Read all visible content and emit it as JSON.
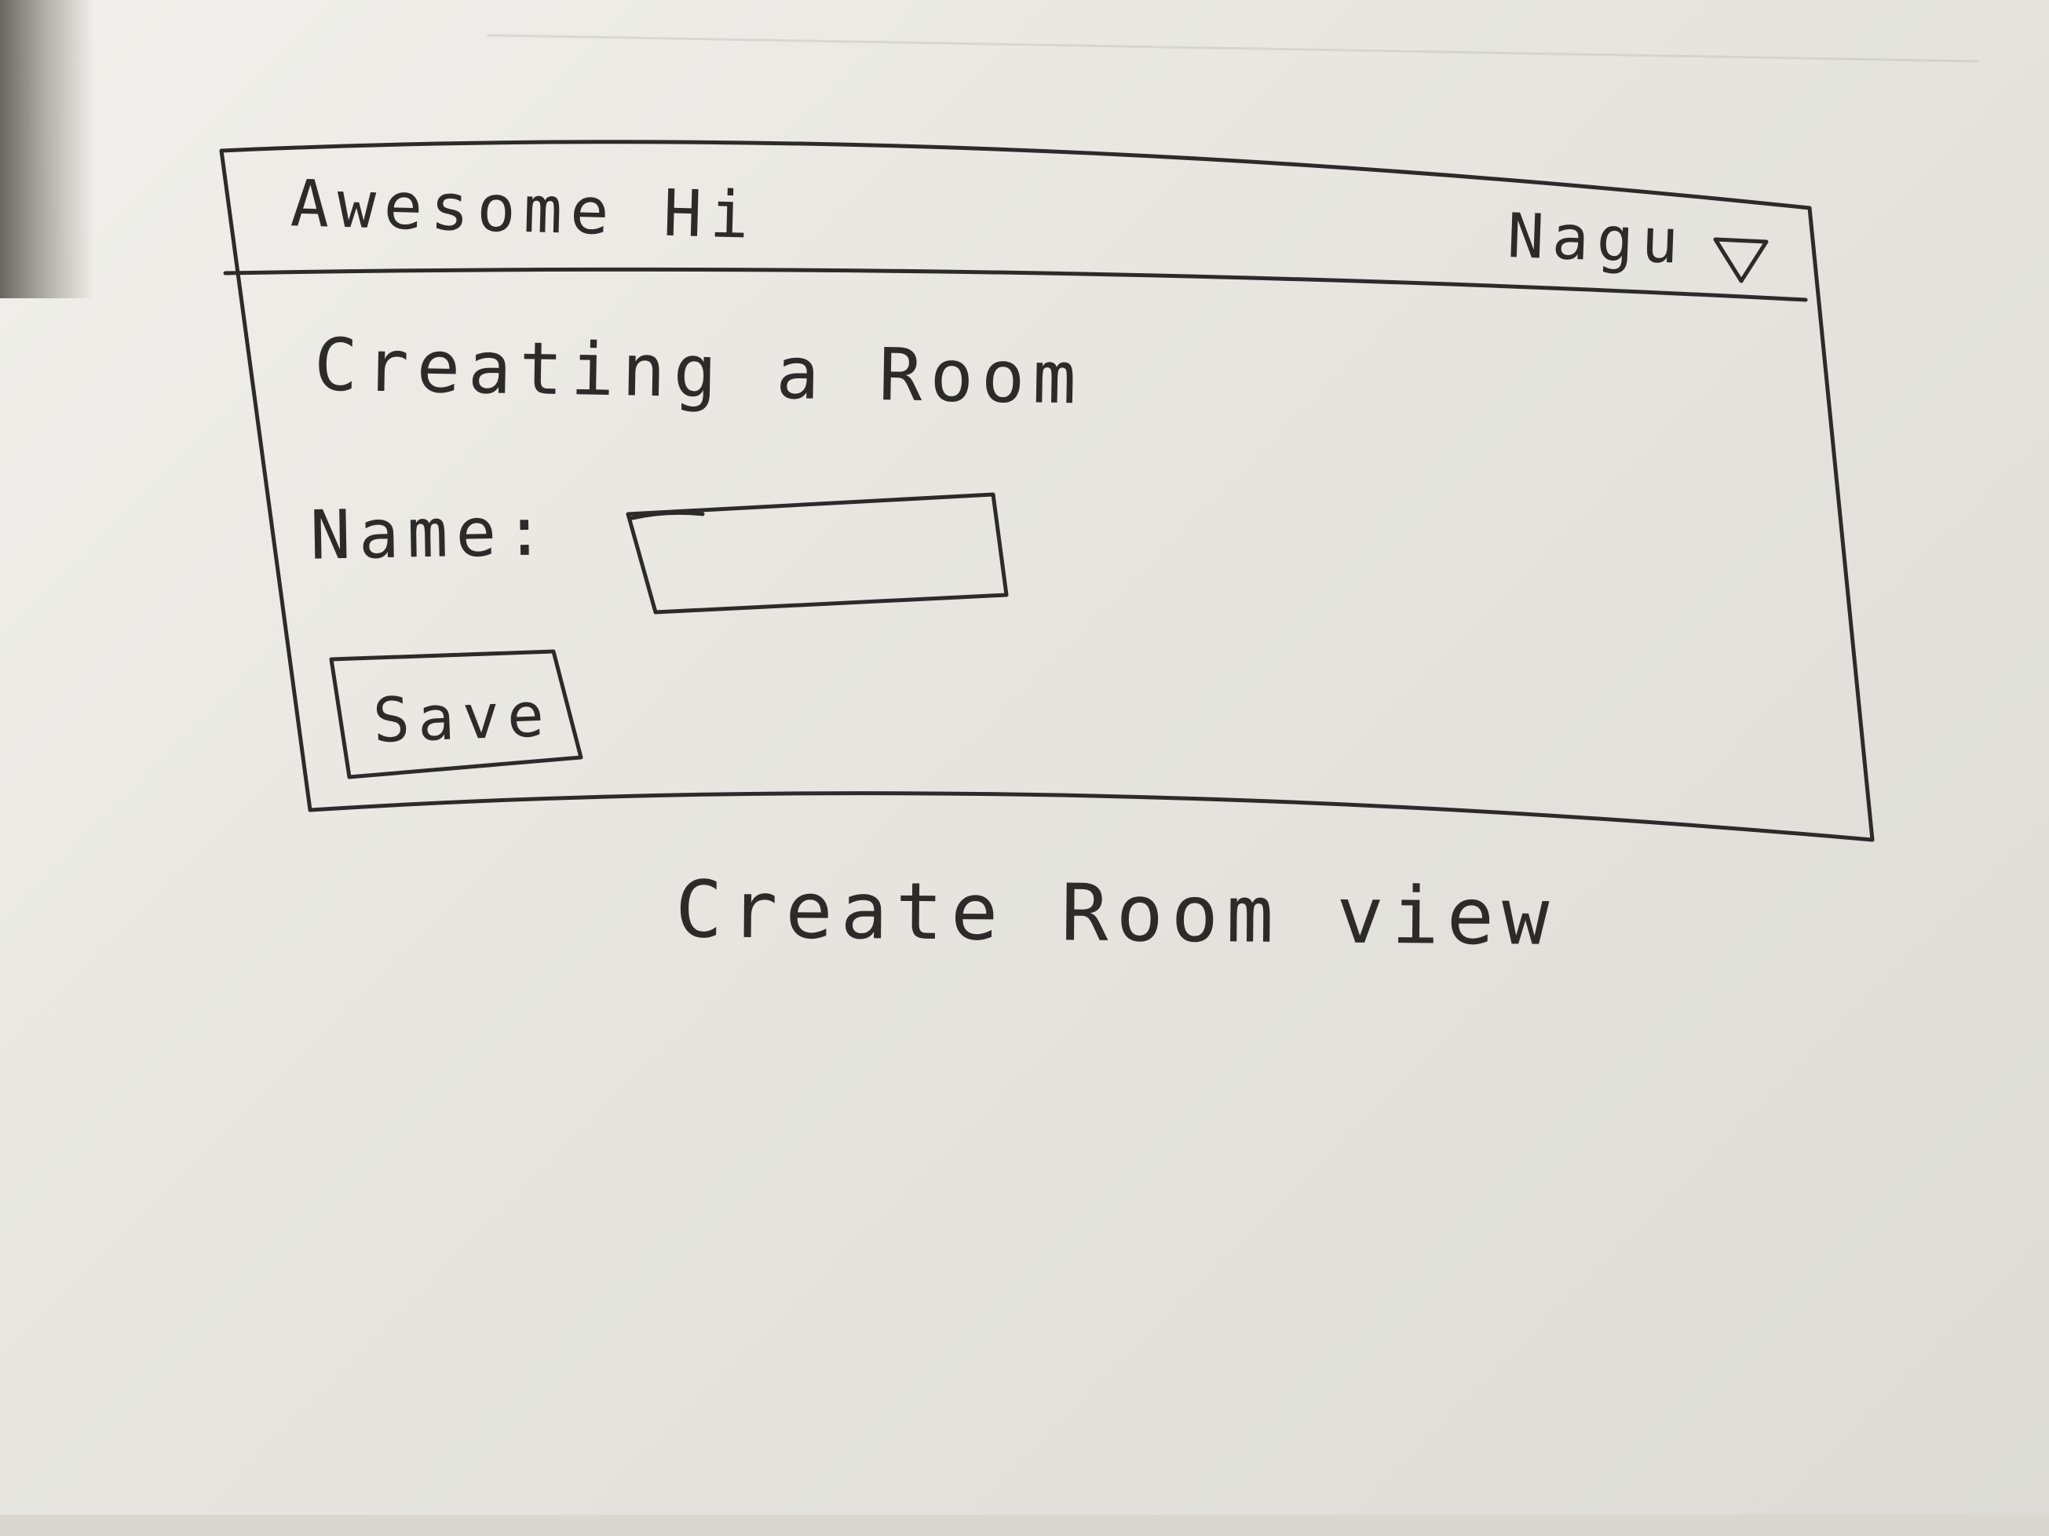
{
  "header": {
    "app_title": "Awesome Hi",
    "user_name": "Nagu"
  },
  "main": {
    "page_title": "Creating a Room",
    "form": {
      "name_label": "Name:",
      "name_value": "",
      "save_label": "Save"
    }
  },
  "caption": "Create Room view",
  "icons": {
    "user_menu": "dropdown-triangle-icon"
  },
  "colors": {
    "paper": "#ecebe6",
    "ink": "#2c2b2a"
  }
}
